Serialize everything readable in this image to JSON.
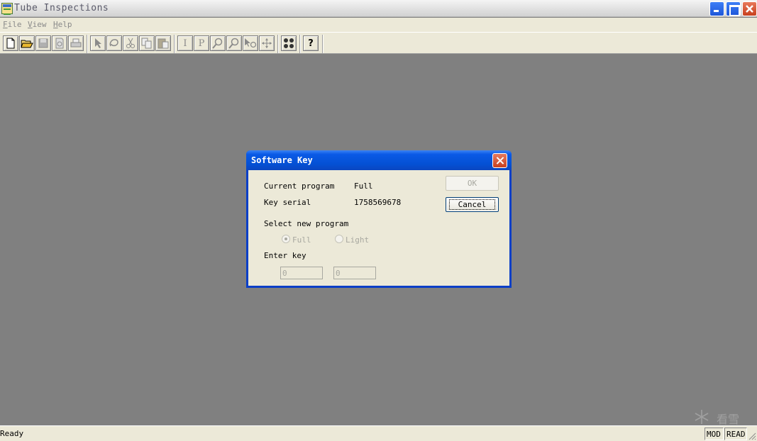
{
  "window": {
    "title": "Tube Inspections"
  },
  "menu": {
    "items": [
      {
        "letter": "F",
        "rest": "ile"
      },
      {
        "letter": "V",
        "rest": "iew"
      },
      {
        "letter": "H",
        "rest": "elp"
      }
    ]
  },
  "toolbar": {
    "text_icons": {
      "insert": "I",
      "print_preview_p": "P",
      "help": "?"
    }
  },
  "dialog": {
    "title": "Software Key",
    "current_program_label": "Current program",
    "current_program_value": "Full",
    "key_serial_label": "Key serial",
    "key_serial_value": "1758569678",
    "select_label": "Select new program",
    "radio_full": "Full",
    "radio_light": "Light",
    "enter_key_label": "Enter key",
    "key_input_1": "0",
    "key_input_2": "0",
    "ok_label": "OK",
    "cancel_label": "Cancel"
  },
  "status": {
    "text": "Ready",
    "pane_mod": "MOD",
    "pane_read": "READ"
  },
  "watermark": {
    "text": "看雪"
  }
}
